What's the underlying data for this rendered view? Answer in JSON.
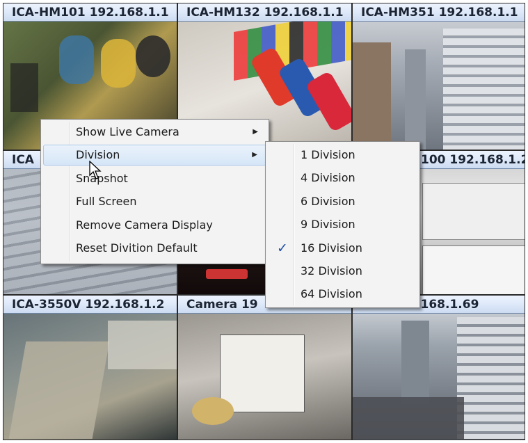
{
  "cameras": [
    {
      "title": "ICA-HM101 192.168.1.1"
    },
    {
      "title": "ICA-HM132 192.168.1.1"
    },
    {
      "title": "ICA-HM351 192.168.1.1"
    },
    {
      "title": "ICA"
    },
    {
      "title": ""
    },
    {
      "title": "100 192.168.1.2"
    },
    {
      "title": "ICA-3550V 192.168.1.2"
    },
    {
      "title": "Camera 19"
    },
    {
      "title": "10 192.168.1.69"
    }
  ],
  "context_menu": {
    "items": [
      {
        "label": "Show Live Camera",
        "has_submenu": true
      },
      {
        "label": "Division",
        "has_submenu": true,
        "highlighted": true
      },
      {
        "label": "Snapshot"
      },
      {
        "label": "Full Screen"
      },
      {
        "label": "Remove Camera Display"
      },
      {
        "label": "Reset Divition Default"
      }
    ],
    "arrow_glyph": "▶"
  },
  "division_submenu": {
    "items": [
      {
        "label": "1 Division"
      },
      {
        "label": "4 Division"
      },
      {
        "label": "6 Division"
      },
      {
        "label": "9 Division"
      },
      {
        "label": "16 Division",
        "checked": true
      },
      {
        "label": "32 Division"
      },
      {
        "label": "64 Division"
      }
    ],
    "check_glyph": "✓"
  },
  "colors": {
    "title_bar": "#cddcf2",
    "menu_bg": "#f3f3f3",
    "highlight": "#d6e6f7",
    "check": "#1f4fa8"
  }
}
